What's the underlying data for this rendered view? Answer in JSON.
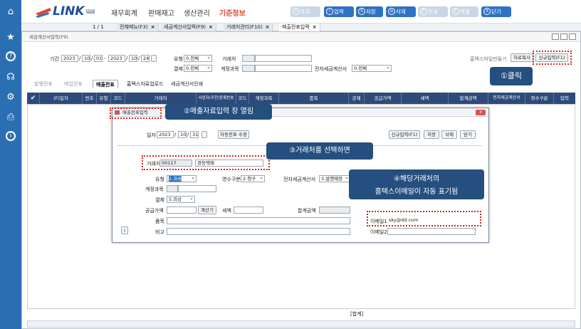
{
  "sidebar": {
    "icons": [
      "home-icon",
      "star-icon",
      "help-icon",
      "headset-icon",
      "gear-icon",
      "printer-icon",
      "info-icon"
    ]
  },
  "topbar": {
    "logo_text": "LINK",
    "logo_badge": "ERP",
    "menus": [
      "재무회계",
      "판매재고",
      "생산관리",
      "기준정보"
    ],
    "buttons": [
      {
        "label": "조회",
        "icon": "⊙",
        "disabled": true
      },
      {
        "label": "입력",
        "icon": "!",
        "disabled": false
      },
      {
        "label": "저장",
        "icon": "S",
        "disabled": false
      },
      {
        "label": "삭제",
        "icon": "⊖",
        "disabled": false
      },
      {
        "label": "인쇄",
        "icon": "P",
        "disabled": true
      },
      {
        "label": "엑셀",
        "icon": "E",
        "disabled": true
      },
      {
        "label": "닫기",
        "icon": "X",
        "disabled": false
      }
    ]
  },
  "tabs": {
    "pager": "1 / 1",
    "items": [
      "전체메뉴(F3)",
      "세금계산서입력(F9)",
      "거래처관리(F10)",
      "매출전표입력"
    ]
  },
  "window": {
    "title": "세금계산서입력(F9)",
    "period_label": "기간",
    "date_from": [
      "2023",
      "10",
      "01"
    ],
    "date_to": [
      "2023",
      "10",
      "24"
    ],
    "type_label": "유형",
    "type_value": "0.전체",
    "settle_label": "결제",
    "settle_value": "0.전체",
    "partner_label": "거래처",
    "account_label": "계정과목",
    "etax_label": "전자세금계산서",
    "etax_value": "0.전체",
    "hometax_text": "홈택스파일만들기",
    "copy_btn": "자료복사",
    "new_btn": "신규입력(F1)"
  },
  "subtabs": [
    "발행전표",
    "매입전표",
    "매출전표",
    "홈택스자료업로드",
    "세금계산서인쇄"
  ],
  "grid_headers": [
    "✔",
    "(F)일자",
    "번호",
    "유형",
    "코드",
    "거래처",
    "사업자(주민)등록번호",
    "코드",
    "계정과목",
    "품목",
    "공제",
    "공급가액",
    "세액",
    "합계금액",
    "전자세금계산서",
    "영수구분",
    "입력"
  ],
  "footer_sum": "[합계]",
  "dialog": {
    "title": "매출전표입력",
    "date_label": "일자",
    "date": [
      "2023",
      "10",
      "31"
    ],
    "auto_btn": "자동전표 수정",
    "new_btn": "신규입력(F1)",
    "save_btn": "저장",
    "delete_btn": "삭제",
    "close_btn": "닫기",
    "partner_label": "거래처",
    "partner_code": "00117",
    "partner_name": "경동택배",
    "type_label": "유형",
    "type_value": "1.과세",
    "receipt_label": "영수구분",
    "receipt_value": "2.청구",
    "etax_label": "전자세금계산서",
    "etax_value": "3.발행예정",
    "account_label": "계정과목",
    "settle_label": "결제",
    "settle_value": "5.외상",
    "supply_label": "공급가액",
    "calc_btn": "계산기",
    "tax_label": "세액",
    "total_label": "합계금액",
    "item_label": "품목",
    "memo_label": "비고",
    "email1_label": "이메일1",
    "email1_value": "sky@dd.com",
    "email2_label": "이메일2"
  },
  "callouts": {
    "c1": "①클릭",
    "c2": "②매출자료입력 창 열림",
    "c3": "③거래처를 선택하면",
    "c4_line1": "④해당거래처의",
    "c4_line2": "홈텍스이메일이 자동 표기됨"
  }
}
